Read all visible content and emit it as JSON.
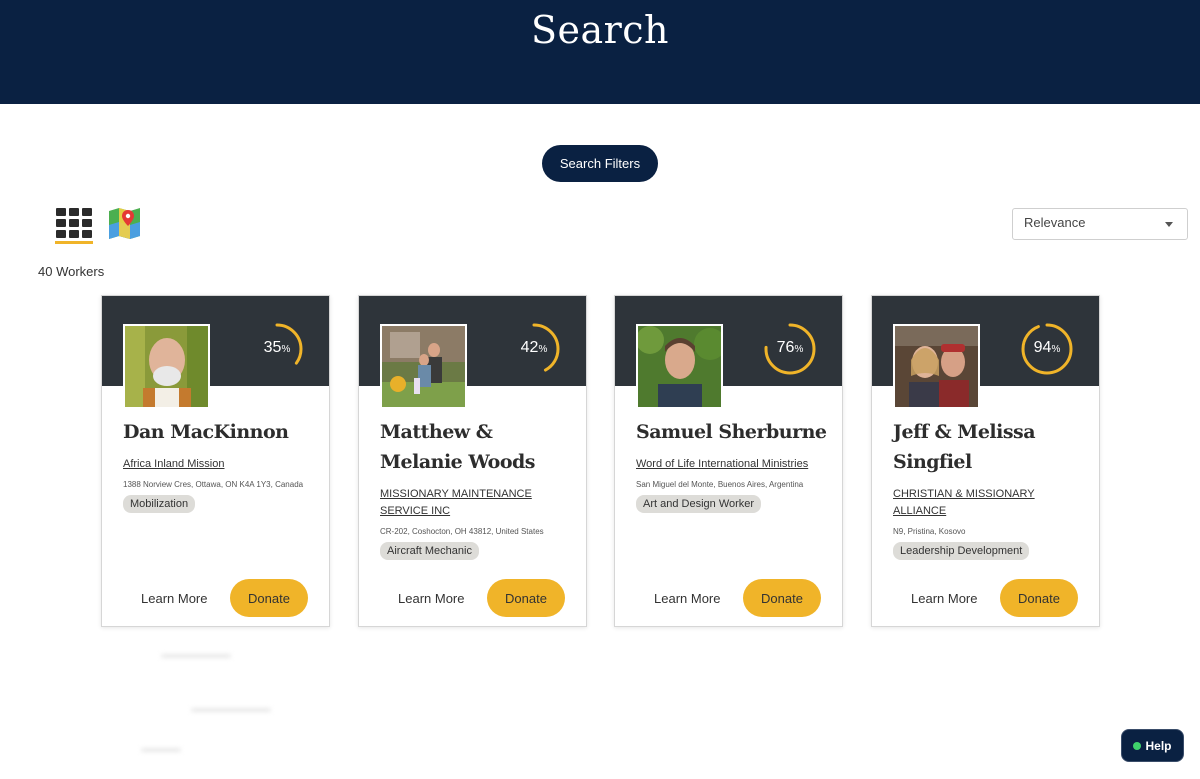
{
  "header": {
    "title": "Search"
  },
  "filters_button": "Search Filters",
  "view_toggle": {
    "grid_icon": "grid-icon",
    "map_icon": "map-icon"
  },
  "sort": {
    "selected": "Relevance"
  },
  "results_count": "40 Workers",
  "cards": [
    {
      "name": "Dan MacKinnon",
      "org": "Africa Inland Mission",
      "address": "1388 Norview Cres, Ottawa, ON K4A 1Y3, Canada",
      "tag": "Mobilization",
      "percent": 35,
      "percent_label": "35",
      "learn_more": "Learn More",
      "donate": "Donate"
    },
    {
      "name": "Matthew & Melanie Woods",
      "org": "MISSIONARY MAINTENANCE SERVICE INC",
      "address": "CR-202, Coshocton, OH 43812, United States",
      "tag": "Aircraft Mechanic",
      "percent": 42,
      "percent_label": "42",
      "learn_more": "Learn More",
      "donate": "Donate"
    },
    {
      "name": "Samuel Sherburne",
      "org": "Word of Life International Ministries",
      "address": "San Miguel del Monte, Buenos Aires, Argentina",
      "tag": "Art and Design Worker",
      "percent": 76,
      "percent_label": "76",
      "learn_more": "Learn More",
      "donate": "Donate"
    },
    {
      "name": "Jeff & Melissa Singfiel",
      "org": "CHRISTIAN & MISSIONARY ALLIANCE",
      "address": "N9, Pristina, Kosovo",
      "tag": "Leadership Development",
      "percent": 94,
      "percent_label": "94",
      "learn_more": "Learn More",
      "donate": "Donate"
    }
  ],
  "percent_symbol": "%",
  "help_button": "Help",
  "colors": {
    "navy": "#0a2142",
    "band": "#2e343a",
    "accent": "#f0b429",
    "help_dot": "#3fd26b"
  }
}
